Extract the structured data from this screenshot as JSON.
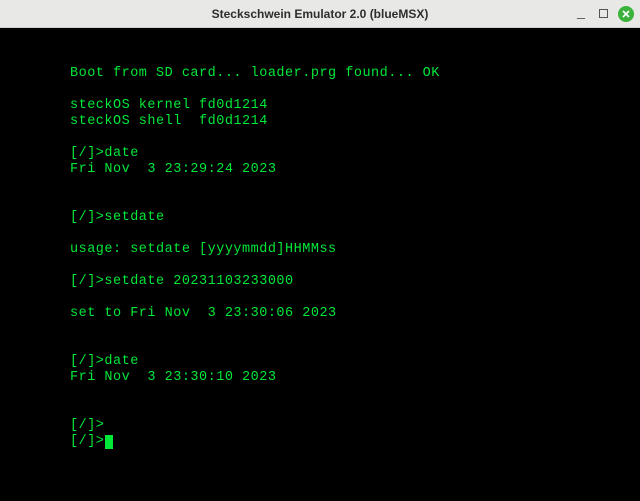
{
  "window": {
    "title": "Steckschwein Emulator 2.0 (blueMSX)"
  },
  "terminal": {
    "lines": [
      "Boot from SD card... loader.prg found... OK",
      "",
      "steckOS kernel fd0d1214",
      "steckOS shell  fd0d1214",
      "",
      "[/]>date",
      "Fri Nov  3 23:29:24 2023",
      "",
      "",
      "[/]>setdate",
      "",
      "usage: setdate [yyyymmdd]HHMMss",
      "",
      "[/]>setdate 20231103233000",
      "",
      "set to Fri Nov  3 23:30:06 2023",
      "",
      "",
      "[/]>date",
      "Fri Nov  3 23:30:10 2023",
      "",
      "",
      "[/]>",
      "[/]>"
    ]
  }
}
